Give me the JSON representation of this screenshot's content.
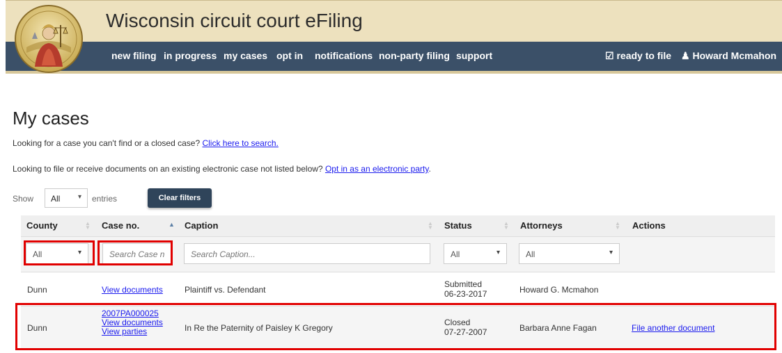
{
  "app": {
    "title": "Wisconsin circuit court eFiling"
  },
  "nav": {
    "items": [
      {
        "label": "new filing"
      },
      {
        "label": "in progress"
      },
      {
        "label": "my cases"
      },
      {
        "label": "opt in"
      },
      {
        "label": "notifications"
      },
      {
        "label": "non-party filing"
      },
      {
        "label": "support"
      }
    ],
    "ready_to_file": "ready to file",
    "user_name": "Howard Mcmahon",
    "icons": {
      "ready": "checkbox-icon",
      "user": "user-icon",
      "caret": "caret-down-icon"
    }
  },
  "page": {
    "title": "My cases",
    "search_prompt": "Looking for a case you can't find or a closed case?",
    "search_link": "Click here to search.",
    "optin_prompt": "Looking to file or receive documents on an existing electronic case not listed below?",
    "optin_link": "Opt in as an electronic party",
    "optin_suffix": "."
  },
  "controls": {
    "show_label": "Show",
    "show_value": "All",
    "entries_label": "entries",
    "clear_filters": "Clear filters"
  },
  "table": {
    "headers": {
      "county": "County",
      "case_no": "Case no.",
      "caption": "Caption",
      "status": "Status",
      "attorneys": "Attorneys",
      "actions": "Actions"
    },
    "filters": {
      "county": "All",
      "case_placeholder": "Search Case n",
      "caption_placeholder": "Search Caption...",
      "status": "All",
      "attorneys": "All"
    },
    "rows": [
      {
        "county": "Dunn",
        "case_links": [
          "View documents"
        ],
        "caption": "Plaintiff vs. Defendant",
        "status": "Submitted",
        "status_date": "06-23-2017",
        "attorney": "Howard G. Mcmahon",
        "action": ""
      },
      {
        "county": "Dunn",
        "case_links": [
          "2007PA000025",
          "View documents",
          "View parties"
        ],
        "caption": "In Re the Paternity of Paisley K Gregory",
        "status": "Closed",
        "status_date": "07-27-2007",
        "attorney": "Barbara Anne Fagan",
        "action": "File another document"
      }
    ]
  },
  "colors": {
    "header_bg": "#ede1be",
    "nav_bg": "#3b5068",
    "button_bg": "#2f445a",
    "link": "#1a1aee",
    "highlight": "#e10000"
  }
}
